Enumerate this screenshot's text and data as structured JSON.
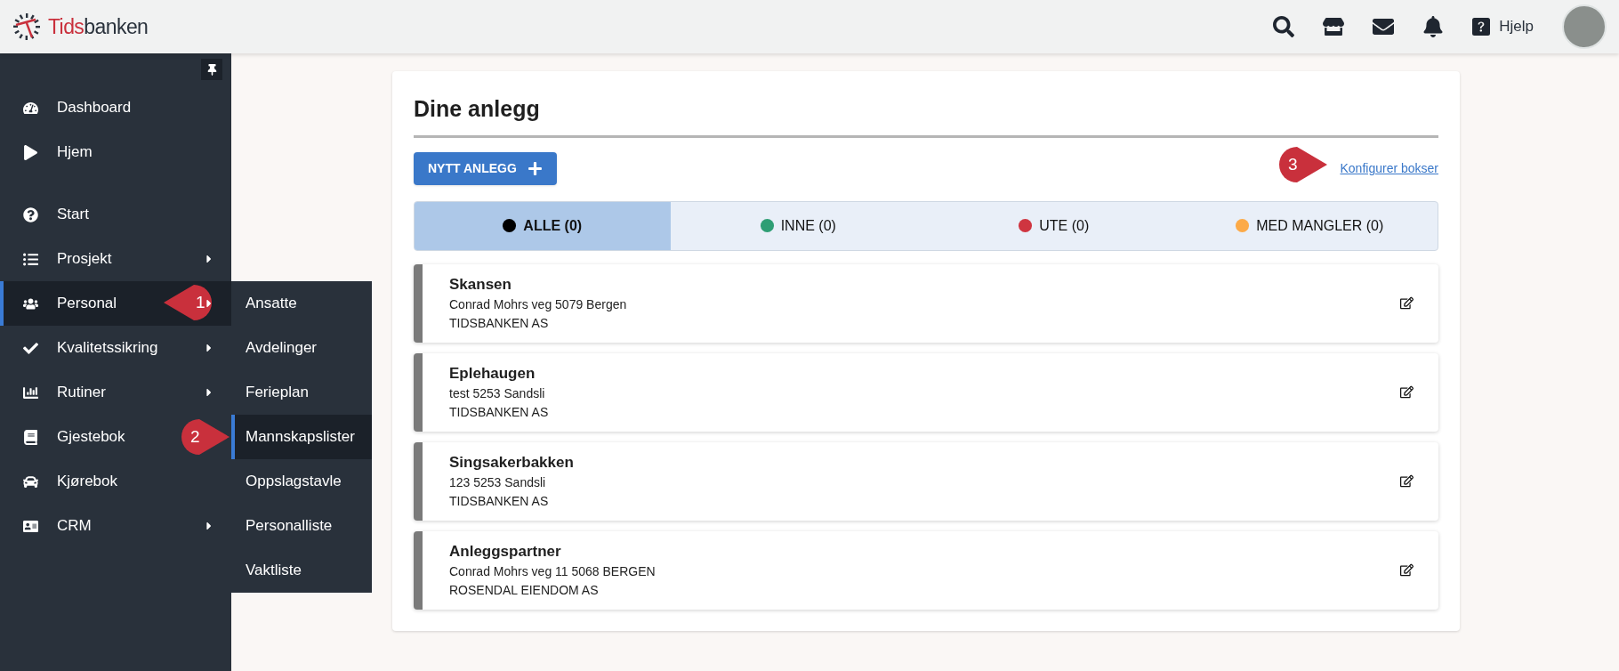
{
  "topbar": {
    "logo": {
      "accent": "Tids",
      "rest": "banken"
    },
    "icons": [
      {
        "kind": "search"
      },
      {
        "kind": "store"
      },
      {
        "kind": "mail"
      },
      {
        "kind": "bell"
      }
    ],
    "help": "Hjelp"
  },
  "sidebar": {
    "sections": [
      [
        {
          "label": "Dashboard",
          "submenu": false,
          "selected": false
        },
        {
          "label": "Hjem",
          "submenu": false,
          "selected": false
        }
      ],
      [
        {
          "label": "Start",
          "submenu": false,
          "selected": false
        },
        {
          "label": "Prosjekt",
          "submenu": true,
          "selected": false
        },
        {
          "label": "Personal",
          "submenu": true,
          "selected": true
        },
        {
          "label": "Kvalitetssikring",
          "submenu": true,
          "selected": false
        },
        {
          "label": "Rutiner",
          "submenu": true,
          "selected": false
        },
        {
          "label": "Gjestebok",
          "submenu": false,
          "selected": false
        },
        {
          "label": "Kjørebok",
          "submenu": false,
          "selected": false
        },
        {
          "label": "CRM",
          "submenu": true,
          "selected": false
        }
      ]
    ]
  },
  "submenu": [
    {
      "label": "Ansatte",
      "selected": false
    },
    {
      "label": "Avdelinger",
      "selected": false
    },
    {
      "label": "Ferieplan",
      "selected": false
    },
    {
      "label": "Mannskapslister",
      "selected": true
    },
    {
      "label": "Oppslagstavle",
      "selected": false
    },
    {
      "label": "Personalliste",
      "selected": false
    },
    {
      "label": "Vaktliste",
      "selected": false
    }
  ],
  "panel": {
    "title": "Dine anlegg",
    "new_button": "NYTT ANLEGG",
    "configure_link": "Konfigurer bokser",
    "filters": [
      {
        "label": "ALLE (0)",
        "color": "#000000",
        "selected": true
      },
      {
        "label": "INNE (0)",
        "color": "#2e9e74",
        "selected": false
      },
      {
        "label": "UTE (0)",
        "color": "#cf3540",
        "selected": false
      },
      {
        "label": "MED MANGLER (0)",
        "color": "#fcaa48",
        "selected": false
      }
    ],
    "sites": [
      {
        "name": "Skansen",
        "address": "Conrad Mohrs veg 5079 Bergen",
        "company": "TIDSBANKEN AS"
      },
      {
        "name": "Eplehaugen",
        "address": "test 5253 Sandsli",
        "company": "TIDSBANKEN AS"
      },
      {
        "name": "Singsakerbakken",
        "address": "123 5253 Sandsli",
        "company": "TIDSBANKEN AS"
      },
      {
        "name": "Anleggspartner",
        "address": "Conrad Mohrs veg 11 5068 BERGEN",
        "company": "ROSENDAL EIENDOM AS"
      }
    ]
  },
  "annotations": [
    {
      "label": "1"
    },
    {
      "label": "2"
    },
    {
      "label": "3"
    }
  ]
}
